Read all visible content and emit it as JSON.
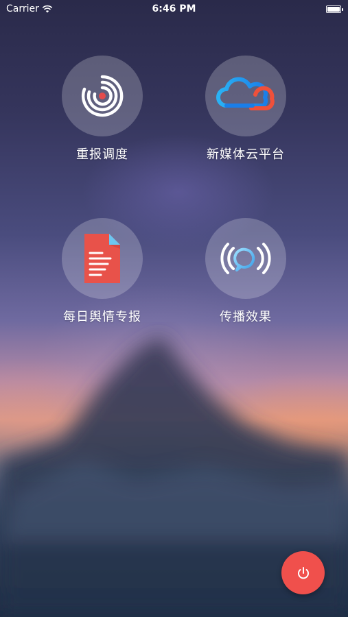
{
  "status_bar": {
    "carrier": "Carrier",
    "time": "6:46 PM",
    "wifi_icon": "wifi-icon",
    "battery_icon": "battery-icon"
  },
  "menu": {
    "items": [
      {
        "label": "重报调度",
        "icon": "radar-icon"
      },
      {
        "label": "新媒体云平台",
        "icon": "cloud-icon"
      },
      {
        "label": "每日舆情专报",
        "icon": "document-icon"
      },
      {
        "label": "传播效果",
        "icon": "broadcast-icon"
      }
    ]
  },
  "power_button": {
    "icon": "power-icon",
    "color": "#f0504c"
  }
}
